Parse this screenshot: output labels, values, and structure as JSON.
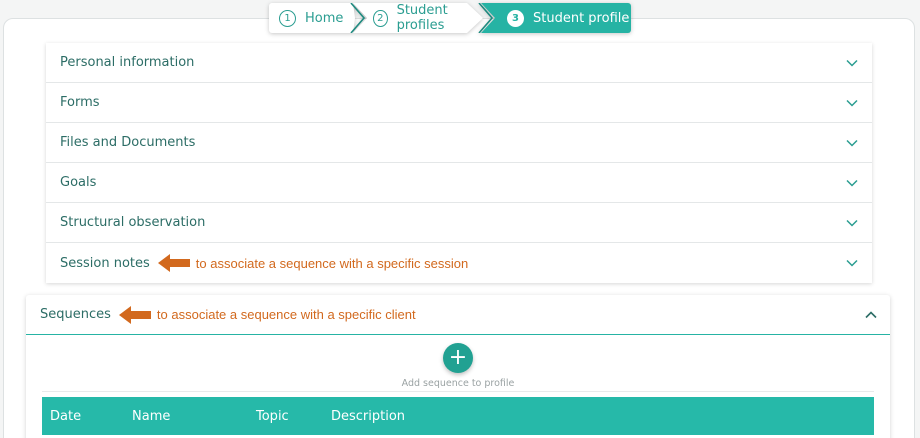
{
  "breadcrumb": {
    "items": [
      {
        "num": "1",
        "label": "Home"
      },
      {
        "num": "2",
        "label": "Student profiles"
      },
      {
        "num": "3",
        "label": "Student profile"
      }
    ]
  },
  "accordion": {
    "items": [
      {
        "label": "Personal information"
      },
      {
        "label": "Forms"
      },
      {
        "label": "Files and Documents"
      },
      {
        "label": "Goals"
      },
      {
        "label": "Structural observation"
      },
      {
        "label": "Session notes",
        "annotation": "to associate a sequence with a specific session"
      }
    ]
  },
  "sequences": {
    "title": "Sequences",
    "annotation": "to associate a sequence with a specific client",
    "add_button": "+",
    "add_label": "Add sequence to profile",
    "columns": [
      "Date",
      "Name",
      "Topic",
      "Description"
    ]
  },
  "colors": {
    "accent": "#26b3a4",
    "annotation": "#d2691e"
  },
  "icons": {
    "expand": "chevron-down-icon",
    "collapse": "chevron-up-icon",
    "annotation_arrow": "arrow-left-icon",
    "add": "plus-icon"
  }
}
